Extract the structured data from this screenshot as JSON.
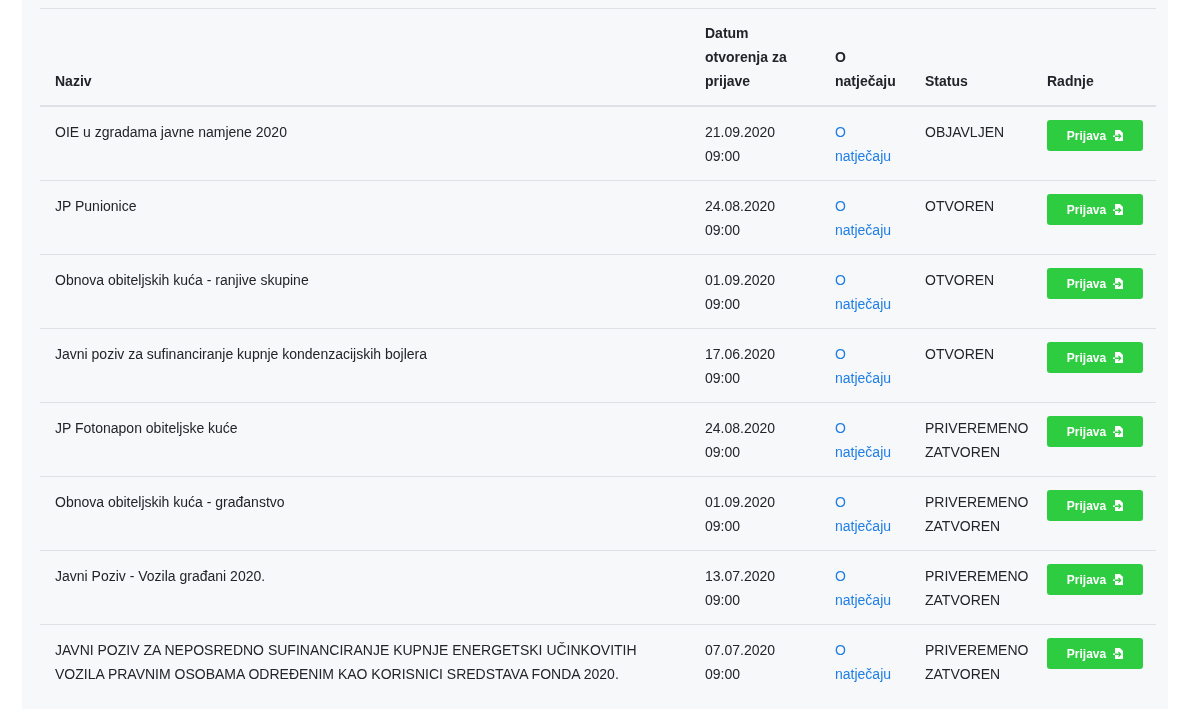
{
  "table": {
    "columns": [
      "Naziv",
      "Datum otvorenja za prijave",
      "O natječaju",
      "Status",
      "Radnje"
    ],
    "rows": [
      {
        "name": "OIE u zgradama javne namjene 2020",
        "date": "21.09.2020 09:00",
        "link": "O natječaju",
        "status": "OBJAVLJEN",
        "action": "Prijava"
      },
      {
        "name": "JP Punionice",
        "date": "24.08.2020 09:00",
        "link": "O natječaju",
        "status": "OTVOREN",
        "action": "Prijava"
      },
      {
        "name": "Obnova obiteljskih kuća - ranjive skupine",
        "date": "01.09.2020 09:00",
        "link": "O natječaju",
        "status": "OTVOREN",
        "action": "Prijava"
      },
      {
        "name": "Javni poziv za sufinanciranje kupnje kondenzacijskih bojlera",
        "date": "17.06.2020 09:00",
        "link": "O natječaju",
        "status": "OTVOREN",
        "action": "Prijava"
      },
      {
        "name": "JP Fotonapon obiteljske kuće",
        "date": "24.08.2020 09:00",
        "link": "O natječaju",
        "status": "PRIVEREMENO ZATVOREN",
        "action": "Prijava"
      },
      {
        "name": "Obnova obiteljskih kuća - građanstvo",
        "date": "01.09.2020 09:00",
        "link": "O natječaju",
        "status": "PRIVEREMENO ZATVOREN",
        "action": "Prijava"
      },
      {
        "name": "Javni Poziv - Vozila građani 2020.",
        "date": "13.07.2020 09:00",
        "link": "O natječaju",
        "status": "PRIVEREMENO ZATVOREN",
        "action": "Prijava"
      },
      {
        "name": "JAVNI POZIV ZA NEPOSREDNO SUFINANCIRANJE KUPNJE ENERGETSKI UČINKOVITIH VOZILA PRAVNIM OSOBAMA ODREĐENIM KAO KORISNICI SREDSTAVA FONDA 2020.",
        "date": "07.07.2020 09:00",
        "link": "O natječaju",
        "status": "PRIVEREMENO ZATVOREN",
        "action": "Prijava"
      }
    ]
  }
}
